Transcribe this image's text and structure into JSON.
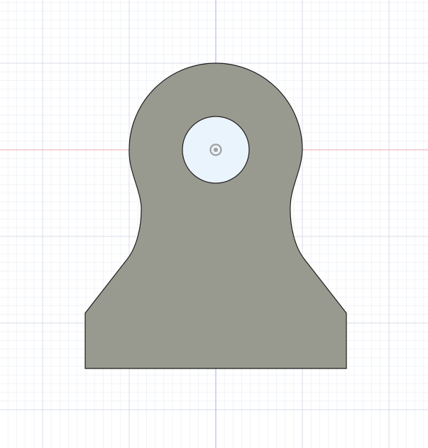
{
  "canvas": {
    "background_color": "#ffffff",
    "grid": {
      "visible": true,
      "minor_color": "#edf0f5",
      "major_color": "#d9dee8"
    },
    "axes": {
      "horizontal_color": "#f2a8b4",
      "vertical_color": "#a9aee6"
    }
  },
  "sketch": {
    "profile": {
      "name": "bracket-profile",
      "fill_color": "#999a8f",
      "stroke_color": "#1e1e1e"
    },
    "hole": {
      "name": "center-hole",
      "fill_color": "#eaf4fd",
      "stroke_color": "#1e1e1e"
    },
    "origin_marker": {
      "icon": "origin-point-icon",
      "color": "#a0a0a0"
    }
  }
}
